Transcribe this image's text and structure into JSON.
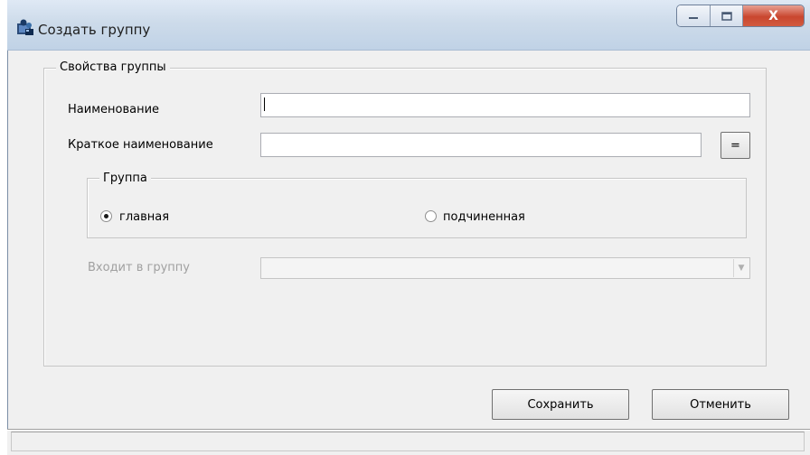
{
  "window": {
    "title": "Создать группу",
    "icon": "group-app-icon",
    "controls": {
      "minimize_icon": "minimize-icon",
      "maximize_icon": "maximize-icon",
      "close_label": "X"
    }
  },
  "properties_group": {
    "legend": "Свойства группы",
    "name_label": "Наименование",
    "name_value": "",
    "short_name_label": "Краткое наименование",
    "short_name_value": "",
    "copy_button_label": "="
  },
  "group_type": {
    "legend": "Группа",
    "options": [
      {
        "label": "главная",
        "checked": true
      },
      {
        "label": "подчиненная",
        "checked": false
      }
    ]
  },
  "parent_group": {
    "label": "Входит в группу",
    "value": "",
    "enabled": false
  },
  "buttons": {
    "save_label": "Сохранить",
    "cancel_label": "Отменить"
  },
  "colors": {
    "titlebar": "#c8d8ea",
    "close_button": "#c9472f",
    "window_bg": "#f0f0f0"
  }
}
